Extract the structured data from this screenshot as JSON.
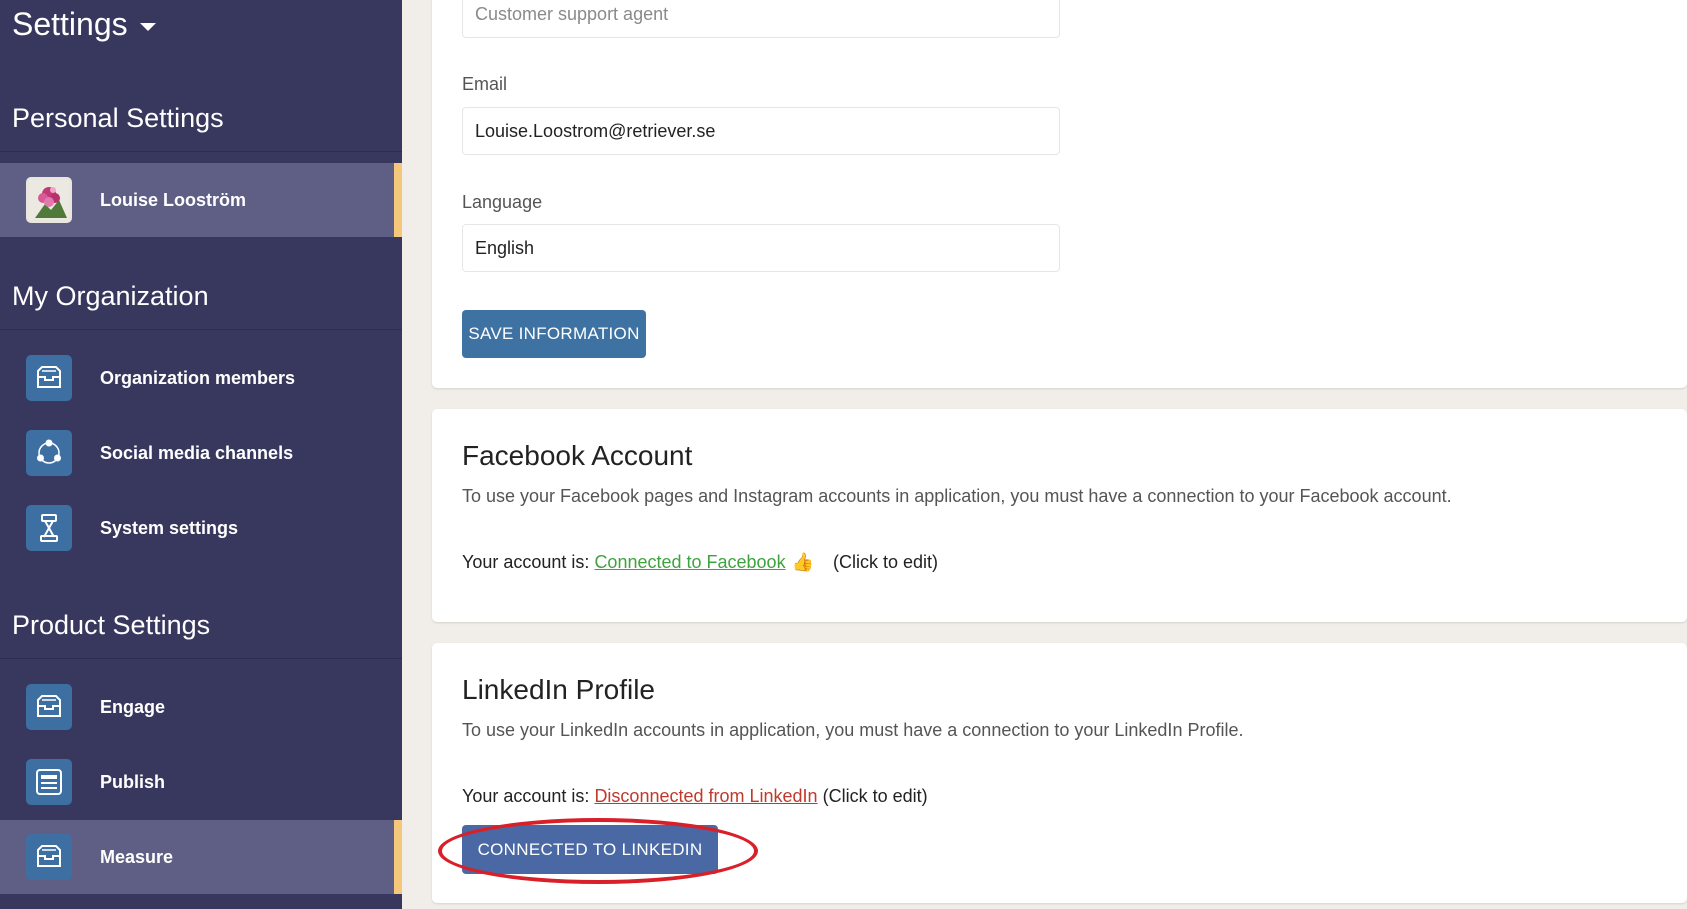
{
  "sidebar": {
    "app_title": "Settings",
    "sections": {
      "personal": "Personal Settings",
      "organization": "My Organization",
      "product": "Product Settings"
    },
    "user": {
      "name": "Louise Looström"
    },
    "org_items": [
      {
        "label": "Organization members",
        "icon": "inbox-icon"
      },
      {
        "label": "Social media channels",
        "icon": "share-nodes-icon"
      },
      {
        "label": "System settings",
        "icon": "robot-icon"
      }
    ],
    "product_items": [
      {
        "label": "Engage",
        "icon": "inbox-icon"
      },
      {
        "label": "Publish",
        "icon": "document-icon"
      },
      {
        "label": "Measure",
        "icon": "inbox-icon"
      }
    ]
  },
  "profile_form": {
    "title_field": {
      "placeholder": "Customer support agent"
    },
    "email": {
      "label": "Email",
      "value": "Louise.Loostrom@retriever.se"
    },
    "language": {
      "label": "Language",
      "value": "English"
    },
    "save_label": "SAVE INFORMATION"
  },
  "facebook": {
    "title": "Facebook Account",
    "description": "To use your Facebook pages and Instagram accounts in application, you must have a connection to your Facebook account.",
    "status_prefix": "Your account is:",
    "status_link": "Connected to Facebook",
    "edit_hint": "(Click to edit)",
    "status_color": "#3ea33e"
  },
  "linkedin": {
    "title": "LinkedIn Profile",
    "description": "To use your LinkedIn accounts in application, you must have a connection to your LinkedIn Profile.",
    "status_prefix": "Your account is:",
    "status_link": "Disconnected from LinkedIn",
    "edit_hint": "(Click to edit)",
    "button_label": "CONNECTED TO LINKEDIN",
    "status_color": "#c0392b"
  },
  "colors": {
    "sidebar_bg": "#38385f",
    "active_item_bg": "#5f5f86",
    "active_indicator": "#f5c77a",
    "icon_bg": "#3d6fa3",
    "primary_button": "#3e72a3",
    "linkedin_button": "#4a68a4",
    "annotation": "#d8202a"
  }
}
